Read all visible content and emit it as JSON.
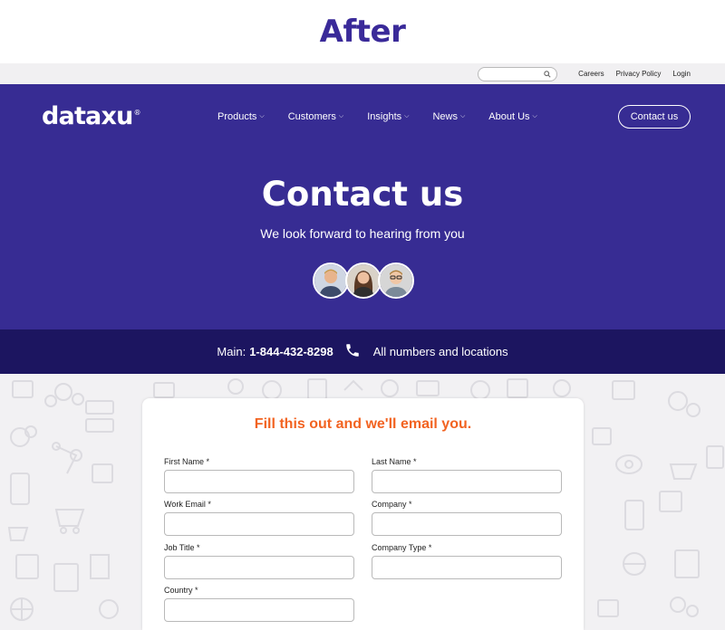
{
  "caption": "After",
  "utility": {
    "search_placeholder": "",
    "links": [
      "Careers",
      "Privacy Policy",
      "Login"
    ]
  },
  "header": {
    "logo": "dataxu",
    "logo_mark": "®",
    "nav": [
      "Products",
      "Customers",
      "Insights",
      "News",
      "About Us"
    ],
    "contact_button": "Contact us"
  },
  "hero": {
    "title": "Contact us",
    "subtitle": "We look forward to hearing from you"
  },
  "phone": {
    "main_label": "Main:",
    "main_number": "1-844-432-8298",
    "all_numbers": "All numbers and locations"
  },
  "form": {
    "heading": "Fill this out and we'll email you.",
    "fields": {
      "first_name": "First Name *",
      "last_name": "Last Name *",
      "work_email": "Work Email *",
      "company": "Company *",
      "job_title": "Job Title *",
      "company_type": "Company Type *",
      "country": "Country *"
    }
  },
  "colors": {
    "brand_purple": "#372c93",
    "phone_bar": "#1c1560",
    "accent_orange": "#f26321"
  }
}
